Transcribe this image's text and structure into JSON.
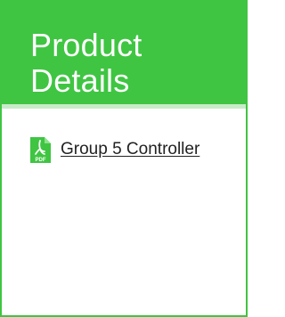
{
  "panel": {
    "title": "Product Details",
    "accent_color": "#3fc542"
  },
  "documents": [
    {
      "label": "Group 5 Controller",
      "icon": "pdf-file-icon",
      "icon_text": "PDF"
    }
  ]
}
